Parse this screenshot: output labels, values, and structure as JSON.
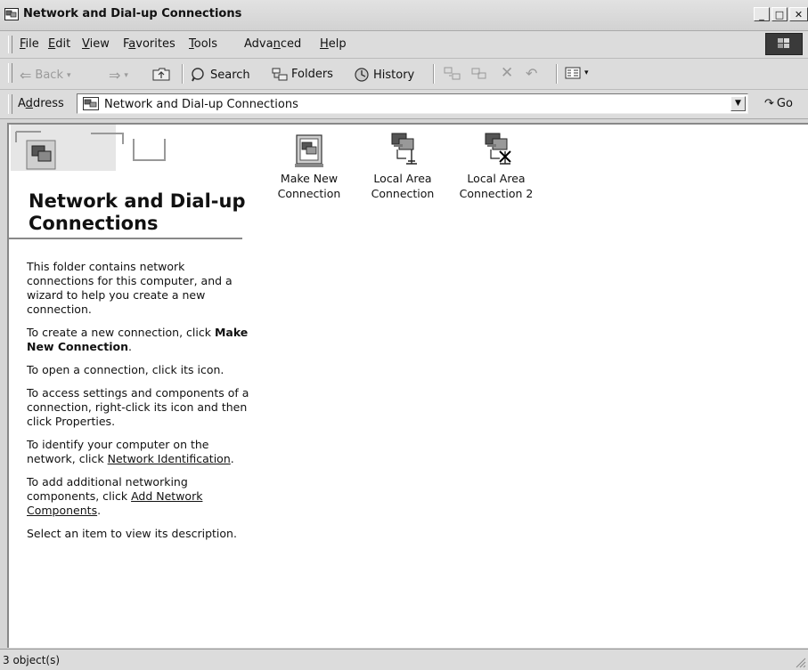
{
  "window": {
    "title": "Network and Dial-up Connections"
  },
  "menu": {
    "items": [
      {
        "pre": "",
        "key": "F",
        "post": "ile"
      },
      {
        "pre": "",
        "key": "E",
        "post": "dit"
      },
      {
        "pre": "",
        "key": "V",
        "post": "iew"
      },
      {
        "pre": "F",
        "key": "a",
        "post": "vorites"
      },
      {
        "pre": "",
        "key": "T",
        "post": "ools"
      },
      {
        "pre": "Adva",
        "key": "n",
        "post": "ced"
      },
      {
        "pre": "",
        "key": "H",
        "post": "elp"
      }
    ]
  },
  "toolbar": {
    "back": "Back",
    "search": "Search",
    "folders": "Folders",
    "history": "History"
  },
  "address": {
    "label": "Address",
    "value": "Network and Dial-up Connections",
    "go": "Go"
  },
  "panel": {
    "title": "Network and Dial-up Connections",
    "p1": "This folder contains network connections for this computer, and a wizard to help you create a new connection.",
    "p2_text": "To create a new connection, click ",
    "p2_bold": "Make New Connection",
    "p2_end": ".",
    "p3": "To open a connection, click its icon.",
    "p4": "To access settings and components of a connection, right-click its icon and then click Properties.",
    "p5_text": "To identify your computer on the network, click ",
    "p5_link": "Network Identification",
    "p5_end": ".",
    "p6_text": "To add additional networking components, click ",
    "p6_link": "Add Network Components",
    "p6_end": ".",
    "p7": "Select an item to view its description."
  },
  "items": [
    {
      "line1": "Make New",
      "line2": "Connection",
      "icon": "make-new-connection-icon"
    },
    {
      "line1": "Local Area",
      "line2": "Connection",
      "icon": "lan-connection-icon"
    },
    {
      "line1": "Local Area",
      "line2": "Connection 2",
      "icon": "lan-disconnected-icon"
    }
  ],
  "status": {
    "text": "3 object(s)"
  }
}
